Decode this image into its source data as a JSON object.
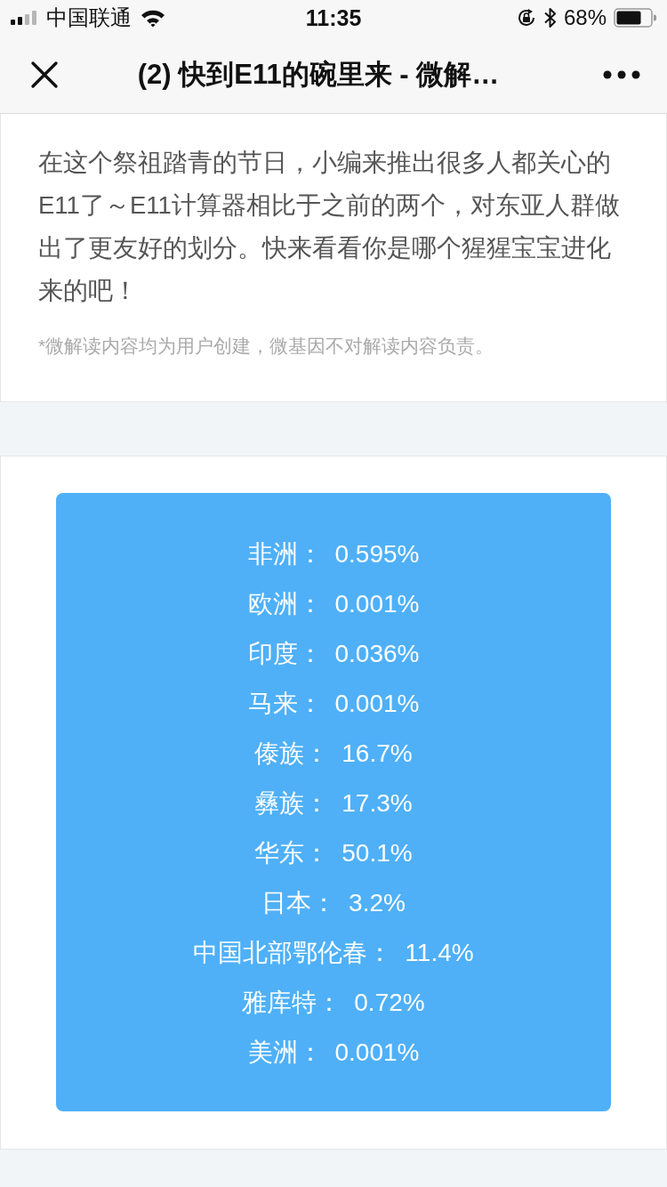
{
  "status_bar": {
    "carrier": "中国联通",
    "time": "11:35",
    "battery": "68%"
  },
  "nav_bar": {
    "title": "(2) 快到E11的碗里来 - 微解…"
  },
  "intro": {
    "text": "在这个祭祖踏青的节日，小编来推出很多人都关心的E11了～E11计算器相比于之前的两个，对东亚人群做出了更友好的划分。快来看看你是哪个猩猩宝宝进化来的吧！",
    "disclaimer": "*微解读内容均为用户创建，微基因不对解读内容负责。"
  },
  "results": [
    {
      "label": "非洲：",
      "value": "0.595%"
    },
    {
      "label": "欧洲：",
      "value": "0.001%"
    },
    {
      "label": "印度：",
      "value": "0.036%"
    },
    {
      "label": "马来：",
      "value": "0.001%"
    },
    {
      "label": "傣族：",
      "value": "16.7%"
    },
    {
      "label": "彝族：",
      "value": "17.3%"
    },
    {
      "label": "华东：",
      "value": "50.1%"
    },
    {
      "label": "日本：",
      "value": "3.2%"
    },
    {
      "label": "中国北部鄂伦春：",
      "value": "11.4%"
    },
    {
      "label": "雅库特：",
      "value": "0.72%"
    },
    {
      "label": "美洲：",
      "value": "0.001%"
    }
  ]
}
